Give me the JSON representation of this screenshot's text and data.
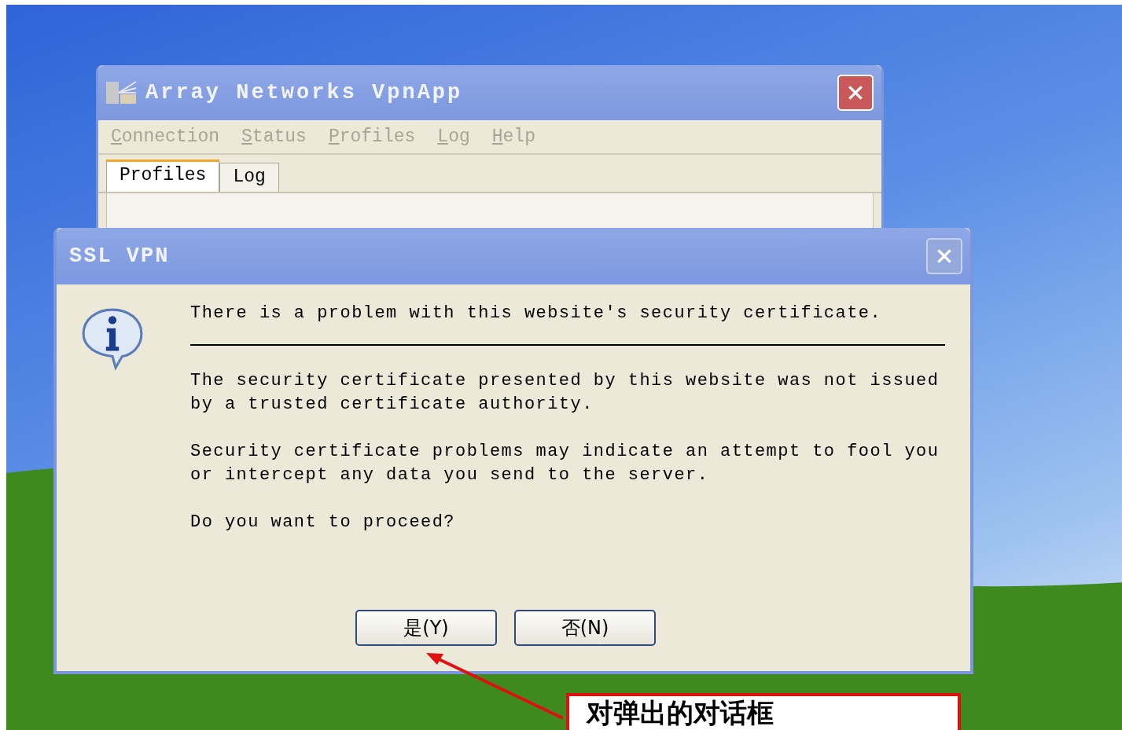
{
  "main_window": {
    "title": "Array Networks VpnApp",
    "menu": [
      {
        "label": "Connection",
        "disabled": true
      },
      {
        "label": "Status",
        "disabled": true
      },
      {
        "label": "Profiles",
        "disabled": true
      },
      {
        "label": "Log",
        "disabled": true
      },
      {
        "label": "Help",
        "disabled": true
      }
    ],
    "tabs": [
      {
        "label": "Profiles",
        "selected": true
      },
      {
        "label": "Log",
        "selected": false
      }
    ]
  },
  "dialog": {
    "title": "SSL VPN",
    "close_disabled": true,
    "heading": "There is a problem with this website's security certificate.",
    "paragraphs": [
      "The security certificate presented by this website was not issued by a trusted certificate authority.",
      "Security certificate problems may indicate an attempt to fool you or intercept any data you send to the server.",
      "Do you want to proceed?"
    ],
    "buttons": [
      "是(Y)",
      "否(N)"
    ]
  },
  "annotation": {
    "text": "对弹出的对话框"
  }
}
